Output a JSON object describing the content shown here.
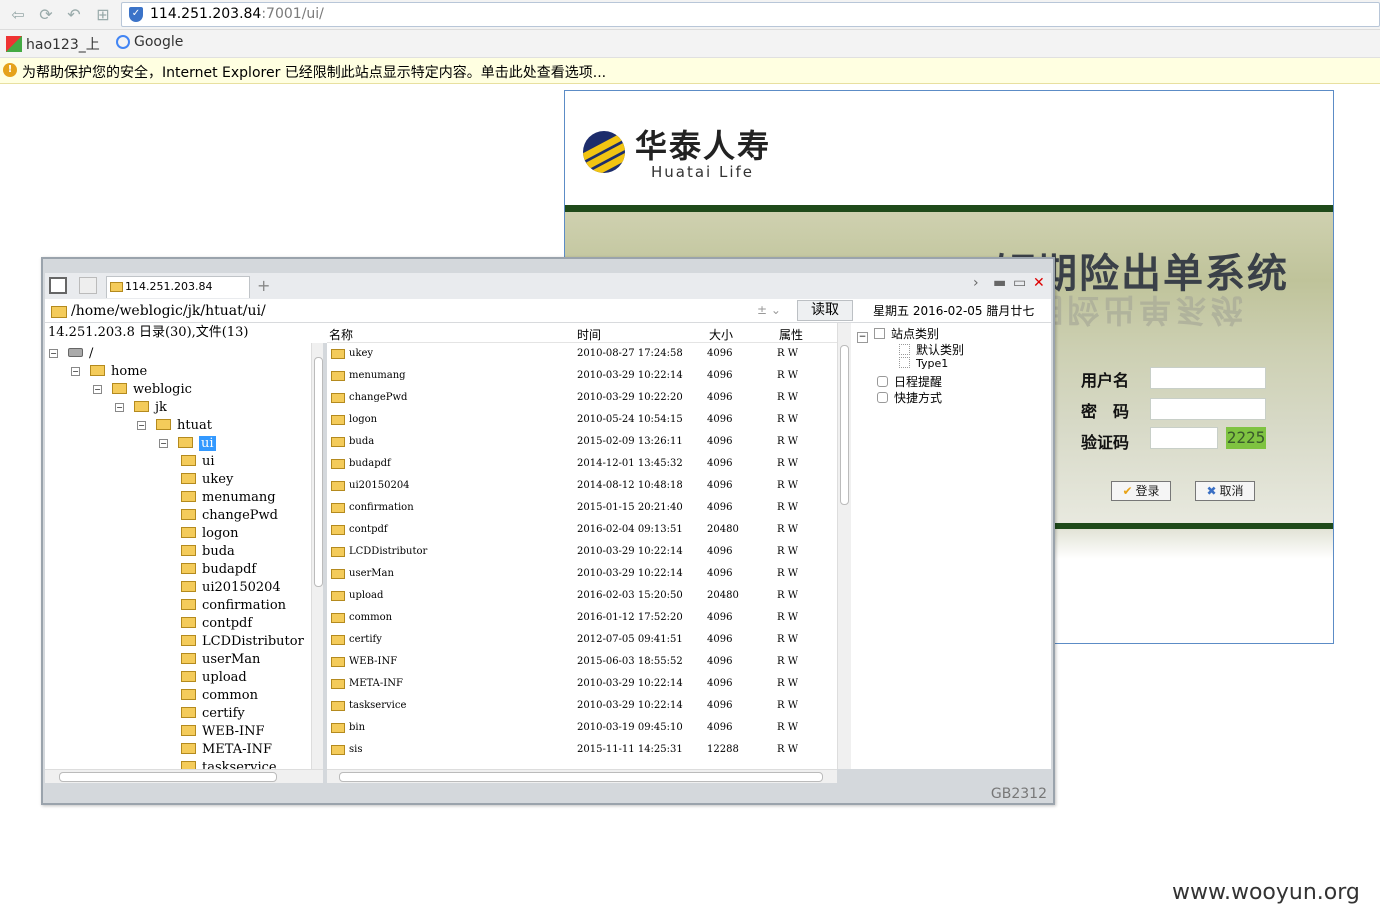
{
  "browser": {
    "url_host": "114.251.203.84",
    "url_rest": ":7001/ui/",
    "nav_icons": [
      "back-icon",
      "forward-icon",
      "back-history-icon",
      "apps-icon"
    ],
    "bookmarks": [
      {
        "label": "hao123_上",
        "icon": "hao123-icon"
      },
      {
        "label": "Google",
        "icon": "google-icon"
      }
    ],
    "infobar": "为帮助保护您的安全，Internet Explorer 已经限制此站点显示特定内容。单击此处查看选项..."
  },
  "site": {
    "brand_cn": "华泰人寿",
    "brand_en": "Huatai Life",
    "system_title": "短期险出单系统",
    "username_label": "用户名",
    "password_label": "密　码",
    "captcha_label": "验证码",
    "captcha_code": "2225",
    "login_label": "登录",
    "cancel_label": "取消",
    "colors": {
      "accent_bar": "#1f4a1a",
      "captcha_bg": "#7fc341"
    }
  },
  "filemgr": {
    "tab_label": "114.251.203.84",
    "path": "/home/weblogic/jk/htuat/ui/",
    "read_label": "读取",
    "date_text": "星期五  2016-02-05  腊月廿七",
    "left_header": "14.251.203.8 日录(30),文件(13)",
    "tree": [
      {
        "label": "/",
        "depth": 0,
        "type": "drive",
        "exp": "⊟"
      },
      {
        "label": "home",
        "depth": 1,
        "type": "folder",
        "exp": "⊟"
      },
      {
        "label": "weblogic",
        "depth": 2,
        "type": "folder",
        "exp": "⊟"
      },
      {
        "label": "jk",
        "depth": 3,
        "type": "folder",
        "exp": "⊟"
      },
      {
        "label": "htuat",
        "depth": 4,
        "type": "folder",
        "exp": "⊟"
      },
      {
        "label": "ui",
        "depth": 5,
        "type": "folder",
        "exp": "⊟",
        "selected": true
      },
      {
        "label": "ui",
        "depth": 6,
        "type": "folder"
      },
      {
        "label": "ukey",
        "depth": 6,
        "type": "folder"
      },
      {
        "label": "menumang",
        "depth": 6,
        "type": "folder"
      },
      {
        "label": "changePwd",
        "depth": 6,
        "type": "folder"
      },
      {
        "label": "logon",
        "depth": 6,
        "type": "folder"
      },
      {
        "label": "buda",
        "depth": 6,
        "type": "folder"
      },
      {
        "label": "budapdf",
        "depth": 6,
        "type": "folder"
      },
      {
        "label": "ui20150204",
        "depth": 6,
        "type": "folder"
      },
      {
        "label": "confirmation",
        "depth": 6,
        "type": "folder"
      },
      {
        "label": "contpdf",
        "depth": 6,
        "type": "folder"
      },
      {
        "label": "LCDDistributor",
        "depth": 6,
        "type": "folder"
      },
      {
        "label": "userMan",
        "depth": 6,
        "type": "folder"
      },
      {
        "label": "upload",
        "depth": 6,
        "type": "folder"
      },
      {
        "label": "common",
        "depth": 6,
        "type": "folder"
      },
      {
        "label": "certify",
        "depth": 6,
        "type": "folder"
      },
      {
        "label": "WEB-INF",
        "depth": 6,
        "type": "folder"
      },
      {
        "label": "META-INF",
        "depth": 6,
        "type": "folder"
      },
      {
        "label": "taskservice",
        "depth": 6,
        "type": "folder"
      }
    ],
    "columns": [
      "名称",
      "时间",
      "大小",
      "属性"
    ],
    "files": [
      {
        "name": "ukey",
        "time": "2010-08-27 17:24:58",
        "size": "4096",
        "attr": "R W"
      },
      {
        "name": "menumang",
        "time": "2010-03-29 10:22:14",
        "size": "4096",
        "attr": "R W"
      },
      {
        "name": "changePwd",
        "time": "2010-03-29 10:22:20",
        "size": "4096",
        "attr": "R W"
      },
      {
        "name": "logon",
        "time": "2010-05-24 10:54:15",
        "size": "4096",
        "attr": "R W"
      },
      {
        "name": "buda",
        "time": "2015-02-09 13:26:11",
        "size": "4096",
        "attr": "R W"
      },
      {
        "name": "budapdf",
        "time": "2014-12-01 13:45:32",
        "size": "4096",
        "attr": "R W"
      },
      {
        "name": "ui20150204",
        "time": "2014-08-12 10:48:18",
        "size": "4096",
        "attr": "R W"
      },
      {
        "name": "confirmation",
        "time": "2015-01-15 20:21:40",
        "size": "4096",
        "attr": "R W"
      },
      {
        "name": "contpdf",
        "time": "2016-02-04 09:13:51",
        "size": "20480",
        "attr": "R W"
      },
      {
        "name": "LCDDistributor",
        "time": "2010-03-29 10:22:14",
        "size": "4096",
        "attr": "R W"
      },
      {
        "name": "userMan",
        "time": "2010-03-29 10:22:14",
        "size": "4096",
        "attr": "R W"
      },
      {
        "name": "upload",
        "time": "2016-02-03 15:20:50",
        "size": "20480",
        "attr": "R W"
      },
      {
        "name": "common",
        "time": "2016-01-12 17:52:20",
        "size": "4096",
        "attr": "R W"
      },
      {
        "name": "certify",
        "time": "2012-07-05 09:41:51",
        "size": "4096",
        "attr": "R W"
      },
      {
        "name": "WEB-INF",
        "time": "2015-06-03 18:55:52",
        "size": "4096",
        "attr": "R W"
      },
      {
        "name": "META-INF",
        "time": "2010-03-29 10:22:14",
        "size": "4096",
        "attr": "R W"
      },
      {
        "name": "taskservice",
        "time": "2010-03-29 10:22:14",
        "size": "4096",
        "attr": "R W"
      },
      {
        "name": "bin",
        "time": "2010-03-19 09:45:10",
        "size": "4096",
        "attr": "R W"
      },
      {
        "name": "sis",
        "time": "2015-11-11 14:25:31",
        "size": "12288",
        "attr": "R W"
      }
    ],
    "right_panel": {
      "site_category": "站点类别",
      "default_category": "默认类别",
      "type1": "Type1",
      "schedule": "日程提醒",
      "shortcut": "快捷方式"
    },
    "encoding": "GB2312"
  },
  "watermark": "www.wooyun.org"
}
